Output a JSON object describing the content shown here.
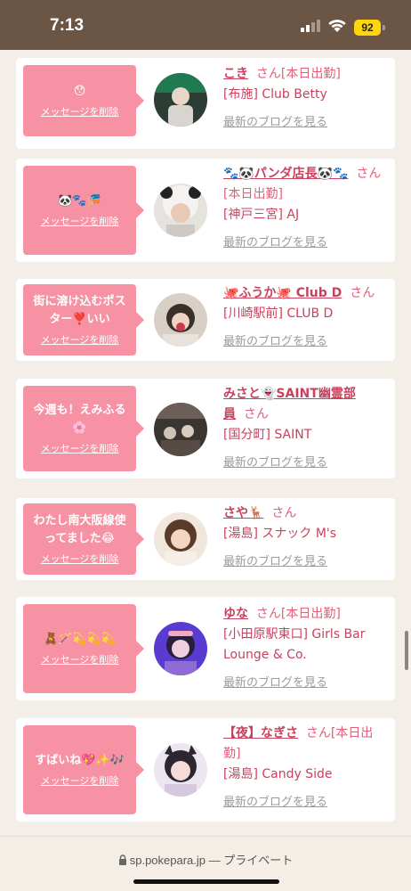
{
  "status": {
    "time": "7:13",
    "battery": "92"
  },
  "cards": [
    {
      "message": "😯",
      "delete_label": "メッセージを削除",
      "name": "こき",
      "san": "さん[本日出勤]",
      "shop": "[布施] Club Betty",
      "blog_label": "最新のブログを見る"
    },
    {
      "message": "🐼🐾🎏",
      "delete_label": "メッセージを削除",
      "name": "🐾🐼パンダ店長🐼🐾",
      "san": "さん[本日出勤]",
      "shop": "[神戸三宮] AJ",
      "blog_label": "最新のブログを見る"
    },
    {
      "message": "街に溶け込むポスター❣️いい",
      "delete_label": "メッセージを削除",
      "name": "🐙ふうか🐙 Club D",
      "san": "さん",
      "shop": "[川崎駅前] CLUB D",
      "blog_label": "最新のブログを見る"
    },
    {
      "message": "今週も！えみふる🌸",
      "delete_label": "メッセージを削除",
      "name": "みさと👻SAINT幽霊部員",
      "san": "さん",
      "shop": "[国分町] SAINT",
      "blog_label": "最新のブログを見る"
    },
    {
      "message": "わたし南大阪線使ってました😂",
      "delete_label": "メッセージを削除",
      "name": "さや🦌",
      "san": "さん",
      "shop": "[湯島] スナック M's",
      "blog_label": "最新のブログを見る"
    },
    {
      "message": "🧸🪄💫💫💫",
      "delete_label": "メッセージを削除",
      "name": "ゆな",
      "san": "さん[本日出勤]",
      "shop": "[小田原駅東口] Girls Bar Lounge & Co.",
      "blog_label": "最新のブログを見る"
    },
    {
      "message": "すばいね💖✨🎶",
      "delete_label": "メッセージを削除",
      "name": "【夜】なぎさ",
      "san": "さん[本日出勤]",
      "shop": "[湯島] Candy Side",
      "blog_label": "最新のブログを見る"
    }
  ],
  "browser": {
    "url": "sp.pokepara.jp",
    "privacy": "— プライベート"
  }
}
